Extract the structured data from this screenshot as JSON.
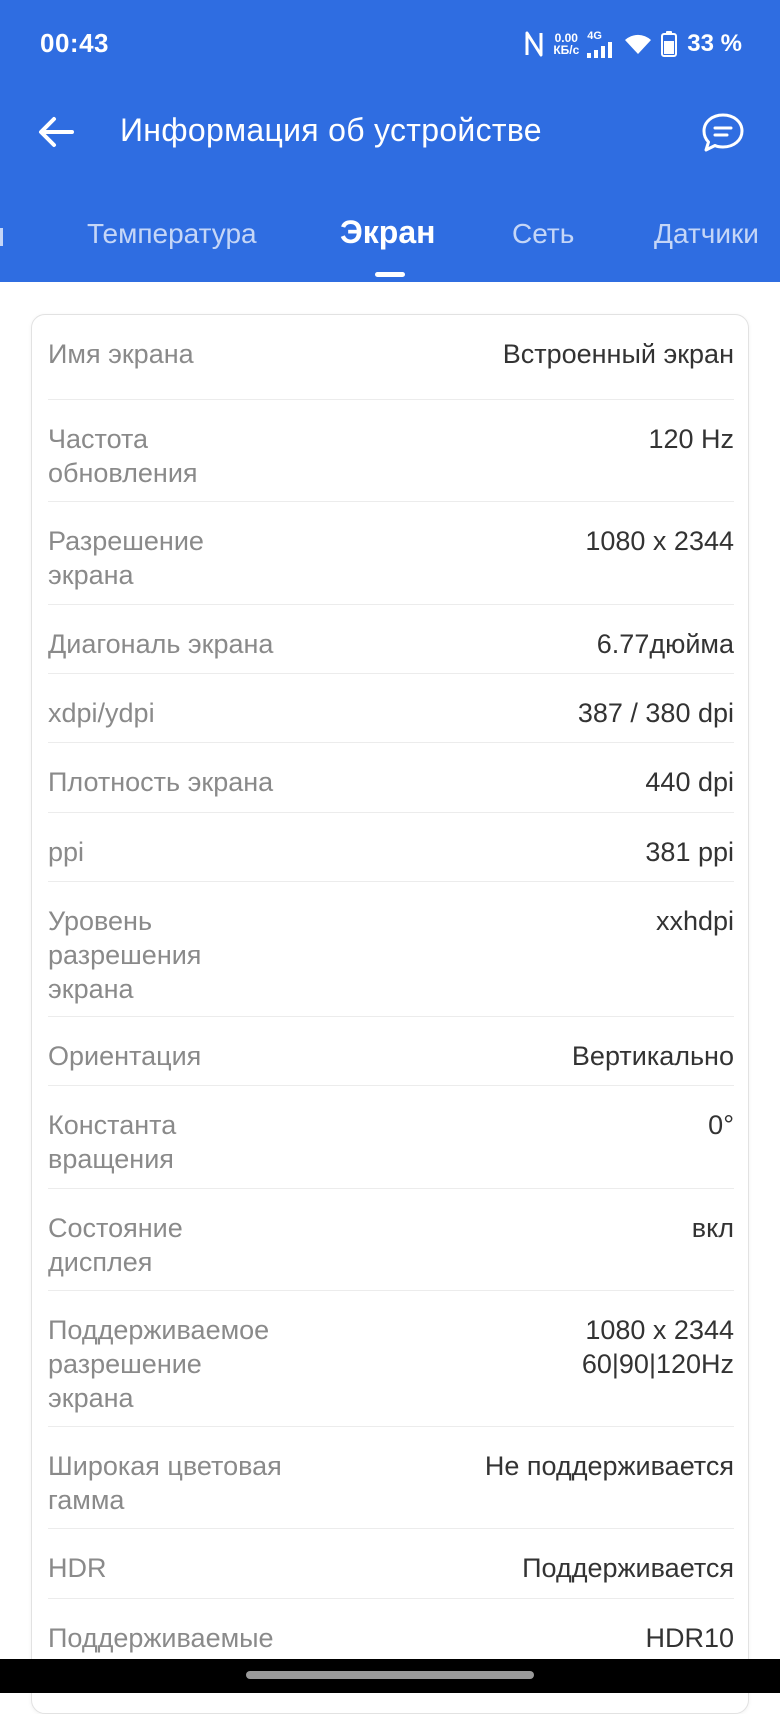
{
  "status_bar": {
    "time": "00:43",
    "nfc_icon": "nfc-icon",
    "net_speed_value": "0.00",
    "net_speed_unit": "КБ/с",
    "network_type": "4G",
    "signal_icon": "signal-icon",
    "wifi_icon": "wifi-icon",
    "battery_icon": "battery-icon",
    "battery": "33 %"
  },
  "toolbar": {
    "back_icon": "arrow-left-icon",
    "title": "Информация об устройстве",
    "chat_icon": "chat-bubble-icon"
  },
  "tabs": [
    {
      "label": "Температура"
    },
    {
      "label": "Экран",
      "active": true
    },
    {
      "label": "Сеть"
    },
    {
      "label": "Датчики"
    }
  ],
  "rows": [
    {
      "label": "Имя экрана",
      "value": "Встроенный экран"
    },
    {
      "label": "Частота\nобновления",
      "value": "120 Hz"
    },
    {
      "label": "Разрешение\nэкрана",
      "value": "1080 x 2344"
    },
    {
      "label": "Диагональ экрана",
      "value": "6.77дюйма"
    },
    {
      "label": "xdpi/ydpi",
      "value": "387 / 380 dpi"
    },
    {
      "label": "Плотность экрана",
      "value": "440 dpi"
    },
    {
      "label": "ppi",
      "value": "381 ppi"
    },
    {
      "label": "Уровень\nразрешения\nэкрана",
      "value": "xxhdpi"
    },
    {
      "label": "Ориентация",
      "value": "Вертикально"
    },
    {
      "label": "Константа\nвращения",
      "value": "0°"
    },
    {
      "label": "Состояние\nдисплея",
      "value": "вкл"
    },
    {
      "label": "Поддерживаемое\nразрешение\nэкрана",
      "value": "1080 x 2344\n60|90|120Hz"
    },
    {
      "label": "Широкая цветовая\nгамма",
      "value": "Не поддерживается"
    },
    {
      "label": "HDR",
      "value": "Поддерживается"
    },
    {
      "label": "Поддерживаемые",
      "value": "HDR10"
    }
  ],
  "colors": {
    "header_bg": "#2f6de1",
    "label_text": "#8a8a8a",
    "value_text": "#333333"
  }
}
